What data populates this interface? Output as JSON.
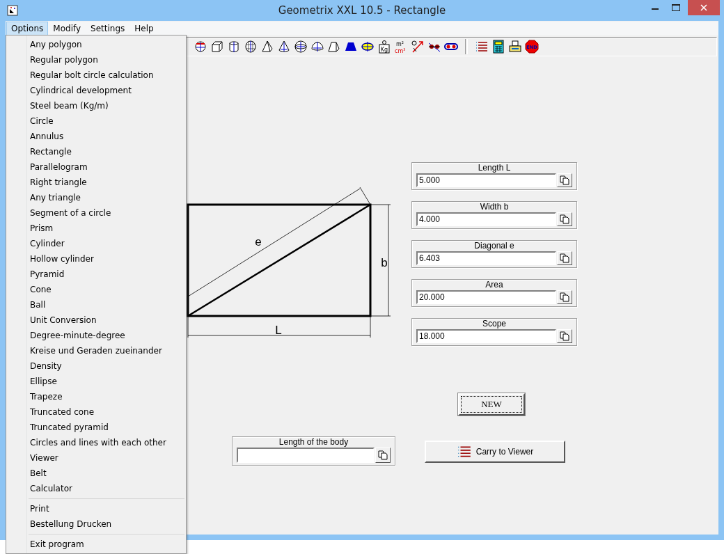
{
  "window": {
    "title": "Geometrix XXL 10.5 - Rectangle"
  },
  "menubar": [
    {
      "label": "Options",
      "selected": true
    },
    {
      "label": "Modify",
      "selected": false
    },
    {
      "label": "Settings",
      "selected": false
    },
    {
      "label": "Help",
      "selected": false
    }
  ],
  "menu": {
    "groups": [
      [
        "Any polygon",
        "Regular polygon",
        "Regular bolt circle calculation",
        "Cylindrical development",
        "Steel beam (Kg/m)",
        "Circle",
        "Annulus",
        "Rectangle",
        "Parallelogram",
        "Right triangle",
        "Any triangle",
        "Segment of a circle",
        "Prism",
        "Cylinder",
        "Hollow cylinder",
        "Pyramid",
        "Cone",
        "Ball",
        "Unit Conversion",
        "Degree-minute-degree",
        "Kreise und Geraden zueinander",
        "Density",
        "Ellipse",
        "Trapeze",
        "Truncated cone",
        "Truncated pyramid",
        "Circles and lines with each other",
        "Viewer",
        "Belt",
        "Calculator"
      ],
      [
        "Print",
        "Bestellung Drucken"
      ],
      [
        "Exit program"
      ]
    ]
  },
  "toolbar": [
    {
      "kind": "circle-cross"
    },
    {
      "kind": "cube"
    },
    {
      "kind": "cylinder"
    },
    {
      "kind": "barrel"
    },
    {
      "kind": "pyramid"
    },
    {
      "kind": "cone"
    },
    {
      "kind": "sphere"
    },
    {
      "kind": "sphere-segment"
    },
    {
      "kind": "frustum"
    },
    {
      "kind": "trapezoid"
    },
    {
      "kind": "ellipse"
    },
    {
      "kind": "weight",
      "text": "Kg"
    },
    {
      "kind": "units",
      "text": "m",
      "sup": "2",
      "text2": "cm",
      "sup2": "3"
    },
    {
      "kind": "angle"
    },
    {
      "kind": "intersection"
    },
    {
      "kind": "belt"
    },
    {
      "kind": "separator"
    },
    {
      "kind": "list"
    },
    {
      "kind": "calculator"
    },
    {
      "kind": "printer"
    },
    {
      "kind": "stop",
      "text": "END"
    }
  ],
  "drawing": {
    "diagonal_label": "e",
    "width_label": "b",
    "length_label": "L"
  },
  "fields": [
    {
      "label": "Length L",
      "value": "5.000"
    },
    {
      "label": "Width b",
      "value": "4.000"
    },
    {
      "label": "Diagonal e",
      "value": "6.403"
    },
    {
      "label": "Area",
      "value": "20.000"
    },
    {
      "label": "Scope",
      "value": "18.000"
    }
  ],
  "new_button": {
    "label": "NEW",
    "focused": true
  },
  "body_length": {
    "label": "Length of the body"
  },
  "carry_button": {
    "label": "Carry to Viewer"
  }
}
